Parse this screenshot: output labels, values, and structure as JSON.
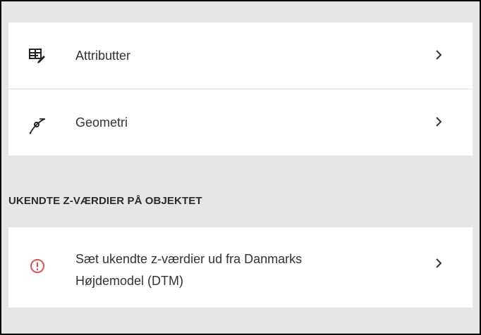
{
  "menu": {
    "items": [
      {
        "label": "Attributter",
        "icon": "table-edit-icon"
      },
      {
        "label": "Geometri",
        "icon": "curve-edit-icon"
      }
    ]
  },
  "unknown_z_section": {
    "heading": "UKENDTE Z-VÆRDIER PÅ OBJEKTET",
    "action": {
      "label_line1": "Sæt ukendte z-værdier ud fra Danmarks",
      "label_line2": "Højdemodel (DTM)",
      "icon": "info-circle-icon"
    }
  },
  "colors": {
    "panel_background": "#e6e6e6",
    "card_background": "#ffffff",
    "warning_icon": "#d9534f",
    "text": "#333333"
  }
}
